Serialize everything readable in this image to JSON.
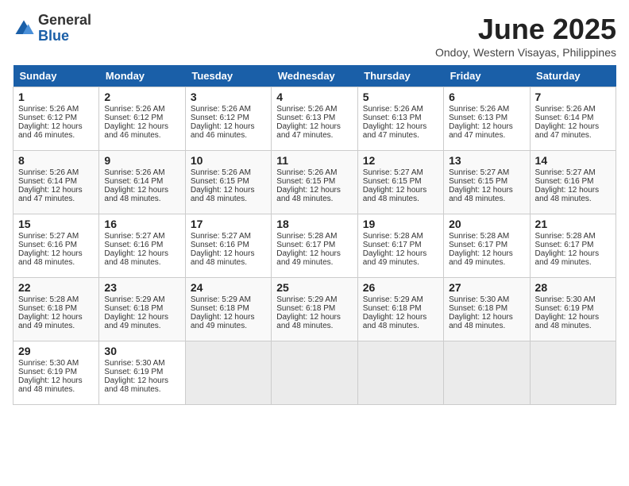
{
  "logo": {
    "general": "General",
    "blue": "Blue"
  },
  "title": "June 2025",
  "location": "Ondoy, Western Visayas, Philippines",
  "days_of_week": [
    "Sunday",
    "Monday",
    "Tuesday",
    "Wednesday",
    "Thursday",
    "Friday",
    "Saturday"
  ],
  "weeks": [
    [
      {
        "day": "1",
        "sunrise": "5:26 AM",
        "sunset": "6:12 PM",
        "daylight": "12 hours and 46 minutes."
      },
      {
        "day": "2",
        "sunrise": "5:26 AM",
        "sunset": "6:12 PM",
        "daylight": "12 hours and 46 minutes."
      },
      {
        "day": "3",
        "sunrise": "5:26 AM",
        "sunset": "6:12 PM",
        "daylight": "12 hours and 46 minutes."
      },
      {
        "day": "4",
        "sunrise": "5:26 AM",
        "sunset": "6:13 PM",
        "daylight": "12 hours and 47 minutes."
      },
      {
        "day": "5",
        "sunrise": "5:26 AM",
        "sunset": "6:13 PM",
        "daylight": "12 hours and 47 minutes."
      },
      {
        "day": "6",
        "sunrise": "5:26 AM",
        "sunset": "6:13 PM",
        "daylight": "12 hours and 47 minutes."
      },
      {
        "day": "7",
        "sunrise": "5:26 AM",
        "sunset": "6:14 PM",
        "daylight": "12 hours and 47 minutes."
      }
    ],
    [
      {
        "day": "8",
        "sunrise": "5:26 AM",
        "sunset": "6:14 PM",
        "daylight": "12 hours and 47 minutes."
      },
      {
        "day": "9",
        "sunrise": "5:26 AM",
        "sunset": "6:14 PM",
        "daylight": "12 hours and 48 minutes."
      },
      {
        "day": "10",
        "sunrise": "5:26 AM",
        "sunset": "6:15 PM",
        "daylight": "12 hours and 48 minutes."
      },
      {
        "day": "11",
        "sunrise": "5:26 AM",
        "sunset": "6:15 PM",
        "daylight": "12 hours and 48 minutes."
      },
      {
        "day": "12",
        "sunrise": "5:27 AM",
        "sunset": "6:15 PM",
        "daylight": "12 hours and 48 minutes."
      },
      {
        "day": "13",
        "sunrise": "5:27 AM",
        "sunset": "6:15 PM",
        "daylight": "12 hours and 48 minutes."
      },
      {
        "day": "14",
        "sunrise": "5:27 AM",
        "sunset": "6:16 PM",
        "daylight": "12 hours and 48 minutes."
      }
    ],
    [
      {
        "day": "15",
        "sunrise": "5:27 AM",
        "sunset": "6:16 PM",
        "daylight": "12 hours and 48 minutes."
      },
      {
        "day": "16",
        "sunrise": "5:27 AM",
        "sunset": "6:16 PM",
        "daylight": "12 hours and 48 minutes."
      },
      {
        "day": "17",
        "sunrise": "5:27 AM",
        "sunset": "6:16 PM",
        "daylight": "12 hours and 48 minutes."
      },
      {
        "day": "18",
        "sunrise": "5:28 AM",
        "sunset": "6:17 PM",
        "daylight": "12 hours and 49 minutes."
      },
      {
        "day": "19",
        "sunrise": "5:28 AM",
        "sunset": "6:17 PM",
        "daylight": "12 hours and 49 minutes."
      },
      {
        "day": "20",
        "sunrise": "5:28 AM",
        "sunset": "6:17 PM",
        "daylight": "12 hours and 49 minutes."
      },
      {
        "day": "21",
        "sunrise": "5:28 AM",
        "sunset": "6:17 PM",
        "daylight": "12 hours and 49 minutes."
      }
    ],
    [
      {
        "day": "22",
        "sunrise": "5:28 AM",
        "sunset": "6:18 PM",
        "daylight": "12 hours and 49 minutes."
      },
      {
        "day": "23",
        "sunrise": "5:29 AM",
        "sunset": "6:18 PM",
        "daylight": "12 hours and 49 minutes."
      },
      {
        "day": "24",
        "sunrise": "5:29 AM",
        "sunset": "6:18 PM",
        "daylight": "12 hours and 49 minutes."
      },
      {
        "day": "25",
        "sunrise": "5:29 AM",
        "sunset": "6:18 PM",
        "daylight": "12 hours and 48 minutes."
      },
      {
        "day": "26",
        "sunrise": "5:29 AM",
        "sunset": "6:18 PM",
        "daylight": "12 hours and 48 minutes."
      },
      {
        "day": "27",
        "sunrise": "5:30 AM",
        "sunset": "6:18 PM",
        "daylight": "12 hours and 48 minutes."
      },
      {
        "day": "28",
        "sunrise": "5:30 AM",
        "sunset": "6:19 PM",
        "daylight": "12 hours and 48 minutes."
      }
    ],
    [
      {
        "day": "29",
        "sunrise": "5:30 AM",
        "sunset": "6:19 PM",
        "daylight": "12 hours and 48 minutes."
      },
      {
        "day": "30",
        "sunrise": "5:30 AM",
        "sunset": "6:19 PM",
        "daylight": "12 hours and 48 minutes."
      },
      null,
      null,
      null,
      null,
      null
    ]
  ],
  "labels": {
    "sunrise": "Sunrise: ",
    "sunset": "Sunset: ",
    "daylight": "Daylight: "
  }
}
